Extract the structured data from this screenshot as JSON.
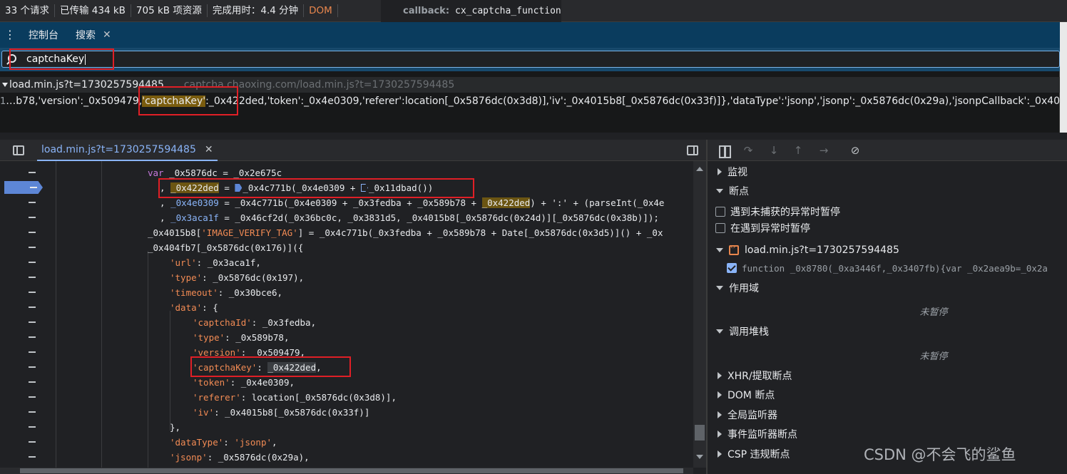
{
  "status_bar": {
    "requests": "33 个请求",
    "transferred": "已传输 434 kB",
    "resources": "705 kB 项资源",
    "finish": "完成用时：4.4 分钟",
    "dom": "DOM",
    "callback_label": "callback:",
    "callback_value": "cx_captcha_function"
  },
  "drawer": {
    "tabs": [
      {
        "label": "控制台"
      },
      {
        "label": "搜索"
      }
    ],
    "close_glyph": "✕"
  },
  "search": {
    "query": "captchaKey"
  },
  "results": {
    "file": "load.min.js?t=1730257594485",
    "url": "captcha.chaoxing.com/load.min.js?t=1730257594485",
    "line_number": "1",
    "line_before": "…b78,'version':_0x509479,",
    "line_match": "'captchaKey'",
    "line_after": ":_0x422ded,'token':_0x4e0309,'referer':location[_0x5876dc(0x3d8)],'iv':_0x4015b8[_0x5876dc(0x33f)]},'dataType':'jsonp','jsonp':_0x5876dc(0x29a),'jsonpCallback':_0x401"
  },
  "sources": {
    "tab_label": "load.min.js?t=1730257594485",
    "close_glyph": "✕"
  },
  "code": {
    "l1_kw": "var",
    "l1_rest": " _0x5876dc = _0x2e675c",
    "l2_pre": ", ",
    "l2_var": "_0x422ded",
    "l2_mid": " = ",
    "l2_call": "_0x4c771b(_0x4e0309 + ",
    "l2_end": "_0x11dbad())",
    "l3_pre": ", ",
    "l3_var": "_0x4e0309",
    "l3_mid": " = _0x4c771b(_0x4e0309 + _0x3fedba + _0x589b78 + ",
    "l3_hl": "_0x422ded",
    "l3_end": ") + ':' + (parseInt(_0x4e",
    "l4_pre": ", ",
    "l4_var": "_0x3aca1f",
    "l4_rest": " = _0x46cf2d(_0x36bc0c, _0x3831d5, _0x4015b8[_0x5876dc(0x24d)][_0x5876dc(0x38b)]);",
    "l5_pre": "_0x4015b8[",
    "l5_str": "'IMAGE_VERIFY_TAG'",
    "l5_rest": "] = _0x4c771b(_0x3fedba + _0x589b78 + Date[_0x5876dc(0x3d5)]() + _0x",
    "l6": "_0x404fb7[_0x5876dc(0x176)]({",
    "l7_key": "'url'",
    "l7_val": ": _0x3aca1f,",
    "l8_key": "'type'",
    "l8_val": ": _0x5876dc(0x197),",
    "l9_key": "'timeout'",
    "l9_val": ": _0x30bce6,",
    "l10_key": "'data'",
    "l10_val": ": {",
    "l11_key": "'captchaId'",
    "l11_val": ": _0x3fedba,",
    "l12_key": "'type'",
    "l12_val": ": _0x589b78,",
    "l13_key": "'version'",
    "l13_val": ": _0x509479,",
    "l14_key": "'captchaKey'",
    "l14_mid": ": ",
    "l14_val": "_0x422ded",
    "l14_end": ",",
    "l15_key": "'token'",
    "l15_val": ": _0x4e0309,",
    "l16_key": "'referer'",
    "l16_val": ": location[_0x5876dc(0x3d8)],",
    "l17_key": "'iv'",
    "l17_val": ": _0x4015b8[_0x5876dc(0x33f)]",
    "l18": "},",
    "l19_key": "'dataType'",
    "l19_mid": ": ",
    "l19_val": "'jsonp'",
    "l19_end": ",",
    "l20_key": "'jsonp'",
    "l20_val": ": _0x5876dc(0x29a),"
  },
  "debugger": {
    "watch": "监视",
    "breakpoints": "断点",
    "pause_uncaught": "遇到未捕获的异常时暂停",
    "pause_caught": "在遇到异常时暂停",
    "bp_file": "load.min.js?t=1730257594485",
    "bp_code": "function _0x8780(_0xa3446f,_0x3407fb){var _0x2aea9b=_0x2a",
    "scope": "作用域",
    "not_paused_1": "未暂停",
    "call_stack": "调用堆栈",
    "not_paused_2": "未暂停",
    "xhr": "XHR/提取断点",
    "dom_bp": "DOM 断点",
    "global_listeners": "全局监听器",
    "event_listener_bp": "事件监听器断点",
    "csp_bp": "CSP 违规断点"
  },
  "watermark": "CSDN @不会飞的鲨鱼",
  "colors": {
    "accent": "#8ab4f8",
    "highlight_box": "#e01f26",
    "string": "#f28b54",
    "keyword": "#c678dd"
  }
}
